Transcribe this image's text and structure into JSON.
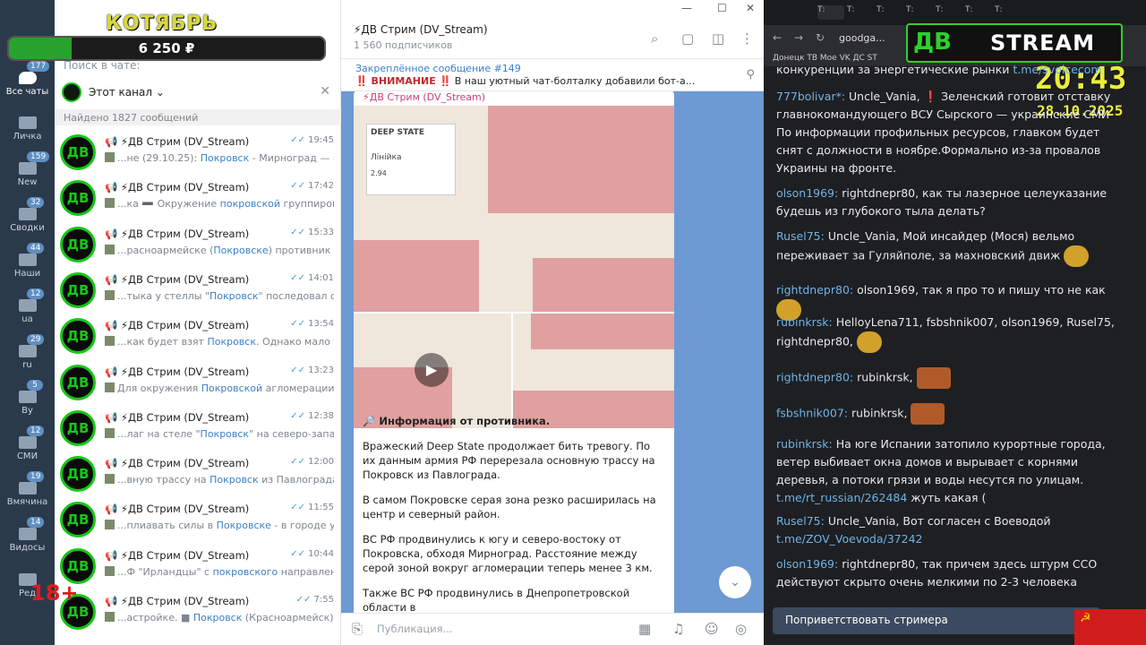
{
  "overlay": {
    "title": "КОТЯБРЬ",
    "amount": "6 250 ₽",
    "progress_fraction": 0.2,
    "age": "18+"
  },
  "rail": [
    {
      "label": "Все чаты",
      "badge": "177"
    },
    {
      "label": "Личка",
      "badge": ""
    },
    {
      "label": "New",
      "badge": "159"
    },
    {
      "label": "Сводки",
      "badge": "32"
    },
    {
      "label": "Наши",
      "badge": "44"
    },
    {
      "label": "ua",
      "badge": "12"
    },
    {
      "label": "ru",
      "badge": "29"
    },
    {
      "label": "By",
      "badge": "5"
    },
    {
      "label": "СМИ",
      "badge": "12"
    },
    {
      "label": "Вмячина",
      "badge": "19"
    },
    {
      "label": "Видосы",
      "badge": "14"
    },
    {
      "label": "Ред",
      "badge": ""
    }
  ],
  "list": {
    "search_placeholder": "Поиск в чате:",
    "filter_channel": "Этот канал",
    "found": "Найдено 1827 сообщений",
    "items": [
      {
        "title": "📢 ⚡ДВ Стрим (DV_Stream)",
        "time": "19:45",
        "pre": "...не (29.10.25): ",
        "hl": "Покровск",
        "post": " - Мирноград — под..."
      },
      {
        "title": "📢 ⚡ДВ Стрим (DV_Stream)",
        "time": "17:42",
        "pre": "...ка ➖ Окружение ",
        "hl": "покровской",
        "post": " группировк..."
      },
      {
        "title": "📢 ⚡ДВ Стрим (DV_Stream)",
        "time": "15:33",
        "pre": "...расноармейске (",
        "hl": "Покровске",
        "post": ") противник забло..."
      },
      {
        "title": "📢 ⚡ДВ Стрим (DV_Stream)",
        "time": "14:01",
        "pre": "...тыка у стеллы \"",
        "hl": "Покровск",
        "post": "\" последовал флаг..."
      },
      {
        "title": "📢 ⚡ДВ Стрим (DV_Stream)",
        "time": "13:54",
        "pre": "...как будет взят ",
        "hl": "Покровск",
        "post": ". Однако мало тог..."
      },
      {
        "title": "📢 ⚡ДВ Стрим (DV_Stream)",
        "time": "13:23",
        "pre": "Для окружения ",
        "hl": "Покровской",
        "post": " агломерации прот..."
      },
      {
        "title": "📢 ⚡ДВ Стрим (DV_Stream)",
        "time": "12:38",
        "pre": "...лаг на стеле \"",
        "hl": "Покровск",
        "post": "\" на северо-запад..."
      },
      {
        "title": "📢 ⚡ДВ Стрим (DV_Stream)",
        "time": "12:00",
        "pre": "...вную трассу на ",
        "hl": "Покровск",
        "post": " из Павлограда."
      },
      {
        "title": "📢 ⚡ДВ Стрим (DV_Stream)",
        "time": "11:55",
        "pre": "...плиавать силы в ",
        "hl": "Покровске",
        "post": " - в городе уже \"..."
      },
      {
        "title": "📢 ⚡ДВ Стрим (DV_Stream)",
        "time": "10:44",
        "pre": "...Ф \"Ирландцы\" с ",
        "hl": "покровского",
        "post": " направлени..."
      },
      {
        "title": "📢 ⚡ДВ Стрим (DV_Stream)",
        "time": "7:55",
        "pre": "...астройке. ■ ",
        "hl": "Покровск",
        "post": " (Красноармейск) ..."
      }
    ]
  },
  "channel": {
    "name": "⚡ДВ Стрим (DV_Stream)",
    "subscribers": "1 560 подписчиков",
    "pinned_title": "Закреплённое сообщение #149",
    "pinned_warn": "‼️ ВНИМАНИЕ ‼️",
    "pinned_text": " В наш уютный чат-болталку добавили бот-а...",
    "post_author": "⚡ДВ Стрим (DV_Stream)",
    "map_brand": "DEEP STATE",
    "map_card_title": "Лінійка",
    "map_card_value": "2.94",
    "post_heading": "🔎 Информация от противника.",
    "paragraphs": [
      "Вражеский Deep State продолжает бить тревогу. По их данным армия РФ перерезала основную трассу на Покровск из Павлограда.",
      "В самом Покровске серая зона резко расширилась на центр и северный район.",
      "ВС РФ продвинулись к югу и северо-востоку от Покровска, обходя Мирноград. Расстояние между серой зоной вокруг агломерации теперь менее 3 км.",
      "Также ВС РФ продвинулись в Днепропетровской области в"
    ],
    "compose_placeholder": "Публикация..."
  },
  "browser": {
    "url": "goodga...",
    "bookmarks": "Донецк   ТВ   Мое   VK   ДС   ST",
    "tabs": [
      "Т:",
      "Т:",
      "Т:",
      "Т:",
      "Т:",
      "Т:",
      "Т:"
    ]
  },
  "stream": {
    "logo_left": "ДВ",
    "logo_right": "STREAM",
    "clock": "20:43",
    "date": "28.10.2025"
  },
  "chat": [
    {
      "nick": "",
      "text": "конкуренции за энергетические рынки ",
      "link": "t.me/svoicecom"
    },
    {
      "nick": "777bolivar*:",
      "text": " Uncle_Vania,  ❗ Зеленский готовит отставку главнокомандующего ВСУ Сырского — украинские СМИ По информации профильных ресурсов, главком будет снят с должности в ноябре.Формально из-за провалов Украины на фронте.",
      "link": ""
    },
    {
      "nick": "olson1969:",
      "text": " rightdnepr80, как ты лазерное целеуказание будешь из глубокого тыла делать?",
      "link": ""
    },
    {
      "nick": "Rusel75:",
      "text": " Uncle_Vania, Мой инсайдер (Мося) вельмо переживает за Гуляйполе, за махновский движ",
      "link": ""
    },
    {
      "nick": "rightdnepr80:",
      "text": " olson1969, так я про то и пишу что не как",
      "link": ""
    },
    {
      "nick": "rubinkrsk:",
      "text": " HelloyLena711, fsbshnik007, olson1969, Rusel75, rightdnepr80,",
      "link": ""
    },
    {
      "nick": "rightdnepr80:",
      "text": " rubinkrsk,",
      "link": ""
    },
    {
      "nick": "fsbshnik007:",
      "text": " rubinkrsk,",
      "link": ""
    },
    {
      "nick": "rubinkrsk:",
      "text": " На юге Испании затопило курортные города, ветер выбивает окна домов и вырывает с корнями деревья, а потоки грязи и воды несутся по улицам. ",
      "link": "t.me/rt_russian/262484",
      "tail": " жуть какая ("
    },
    {
      "nick": "Rusel75:",
      "text": " Uncle_Vania, Вот согласен с Воеводой ",
      "link": "t.me/ZOV_Voevoda/37242"
    },
    {
      "nick": "olson1969:",
      "text": " rightdnepr80, так причем здесь штурм ССО действуют скрыто очень мелкими по 2-3 человека отрядами",
      "link": ""
    }
  ],
  "greet": "Поприветствовать стримера",
  "colors": {
    "accent_green": "#2dd12d",
    "link_blue": "#3a80c8",
    "feed_bg": "#6d9ad3",
    "rail_bg": "#2b3a4b"
  }
}
